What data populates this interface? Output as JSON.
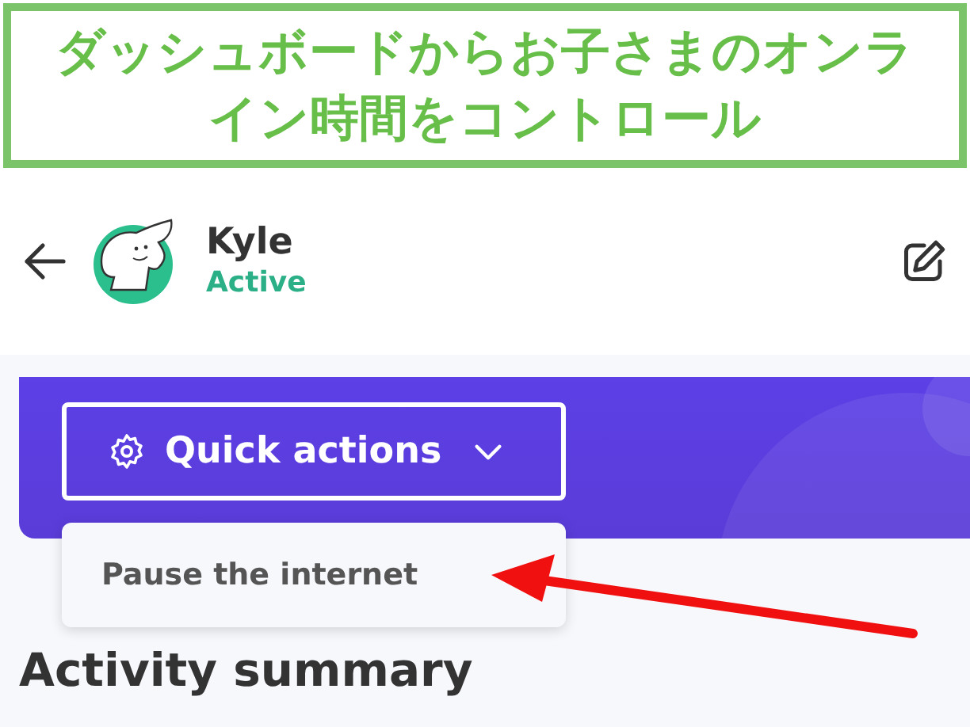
{
  "banner": {
    "text": "ダッシュボードからお子さまのオンライン時間をコントロール"
  },
  "header": {
    "name": "Kyle",
    "status": "Active"
  },
  "quick_actions": {
    "label": "Quick actions",
    "expanded": true,
    "menu_items": [
      {
        "label": "Pause the internet"
      }
    ]
  },
  "section_title": "Activity summary"
}
